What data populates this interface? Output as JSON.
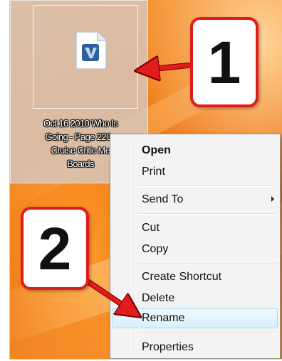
{
  "desktop": {
    "file": {
      "icon": "document-icon",
      "label_lines": [
        "Oct 16 2010 Who Is",
        "Going - Page 220 -",
        "Cruise Critic Me",
        "Boards"
      ]
    }
  },
  "callouts": {
    "one": "1",
    "two": "2",
    "color": "#e01c1c"
  },
  "context_menu": {
    "items": {
      "open": "Open",
      "print": "Print",
      "send_to": "Send To",
      "cut": "Cut",
      "copy": "Copy",
      "create_shortcut": "Create Shortcut",
      "delete": "Delete",
      "rename": "Rename",
      "properties": "Properties"
    },
    "highlighted": "Rename"
  }
}
